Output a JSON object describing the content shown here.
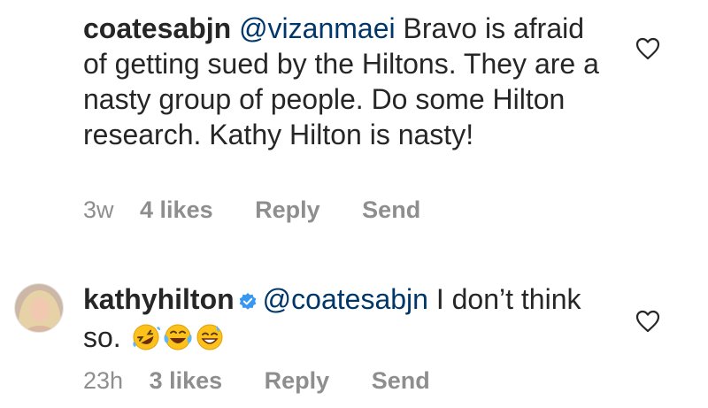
{
  "comments": [
    {
      "username": "coatesabjn",
      "mention": "@vizanmaei",
      "text": " Bravo is afraid of getting sued by the Hiltons. They are a nasty group of people.  Do some Hilton research.  Kathy Hilton is nasty!",
      "time": "3w",
      "likes": "4 likes",
      "reply_label": "Reply",
      "send_label": "Send",
      "verified": false
    },
    {
      "username": "kathyhilton",
      "mention": "@coatesabjn",
      "text": "  I don’t think so.",
      "emojis": [
        "rolling-on-floor-laughing-emoji",
        "tears-of-joy-emoji",
        "grinning-sweat-emoji"
      ],
      "time": "23h",
      "likes": "3 likes",
      "reply_label": "Reply",
      "send_label": "Send",
      "verified": true
    }
  ],
  "colors": {
    "text": "#262626",
    "mention": "#00376b",
    "meta": "#8e8e8e",
    "verified": "#3897f0"
  }
}
